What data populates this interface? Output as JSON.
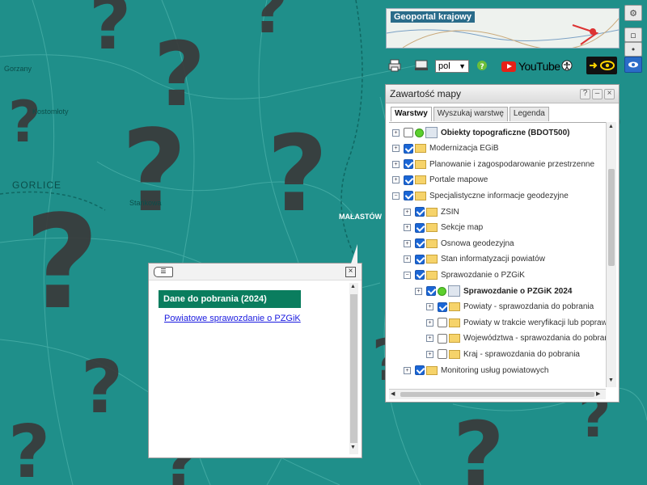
{
  "map": {
    "labels": {
      "city": "GORLICE",
      "town1": "Gorzany",
      "town2": "Stańkowa",
      "town3": "MAŁASTÓW",
      "town4": "Kostomłoty"
    }
  },
  "header": {
    "logo_title": "Geoportal krajowy"
  },
  "toolbar": {
    "language": "pol",
    "youtube_label": "YouTube"
  },
  "panel": {
    "title": "Zawartość mapy",
    "tabs": [
      {
        "label": "Warstwy",
        "active": true
      },
      {
        "label": "Wyszukaj warstwę",
        "active": false
      },
      {
        "label": "Legenda",
        "active": false
      }
    ],
    "rows": [
      {
        "label": "Obiekty topograficzne (BDOT500)",
        "checked": false,
        "type": "service",
        "bold": true,
        "level": 0
      },
      {
        "label": "Modernizacja EGiB",
        "checked": true,
        "type": "folder",
        "level": 0
      },
      {
        "label": "Planowanie i zagospodarowanie przestrzenne",
        "checked": true,
        "type": "folder",
        "level": 0
      },
      {
        "label": "Portale mapowe",
        "checked": true,
        "type": "folder",
        "level": 0
      },
      {
        "label": "Specjalistyczne informacje geodezyjne",
        "checked": true,
        "type": "folder",
        "level": 0,
        "expanded": true
      },
      {
        "label": "ZSIN",
        "checked": true,
        "type": "folder",
        "level": 1
      },
      {
        "label": "Sekcje map",
        "checked": true,
        "type": "folder",
        "level": 1
      },
      {
        "label": "Osnowa geodezyjna",
        "checked": true,
        "type": "folder",
        "level": 1
      },
      {
        "label": "Stan informatyzacji powiatów",
        "checked": true,
        "type": "folder",
        "level": 1
      },
      {
        "label": "Sprawozdanie o PZGiK",
        "checked": true,
        "type": "folder",
        "level": 1,
        "expanded": true
      },
      {
        "label": "Sprawozdanie o PZGiK 2024",
        "checked": true,
        "type": "service",
        "bold": true,
        "level": 2
      },
      {
        "label": "Powiaty - sprawozdania do pobrania",
        "checked": true,
        "type": "folder",
        "level": 3
      },
      {
        "label": "Powiaty w trakcie weryfikacji lub poprawy",
        "checked": false,
        "type": "folder",
        "level": 3
      },
      {
        "label": "Województwa - sprawozdania do pobrania",
        "checked": false,
        "type": "folder",
        "level": 3
      },
      {
        "label": "Kraj - sprawozdania do pobrania",
        "checked": false,
        "type": "folder",
        "level": 3
      },
      {
        "label": "Monitoring usług powiatowych",
        "checked": true,
        "type": "folder",
        "level": 1
      }
    ]
  },
  "popup": {
    "header": "Dane do pobrania (2024)",
    "link": "Powiatowe sprawozdanie o PZGiK"
  },
  "colors": {
    "map_bg": "#1f8f8a",
    "accent": "#0a7d5e",
    "link": "#1a1adf",
    "question_marks": "#3c3c3c"
  },
  "icons": [
    "settings-icon",
    "print-icon",
    "help-icon",
    "accessibility-icon",
    "eye-icon",
    "youtube-icon",
    "folder-icon",
    "wms-icon",
    "list-icon",
    "close-icon"
  ]
}
